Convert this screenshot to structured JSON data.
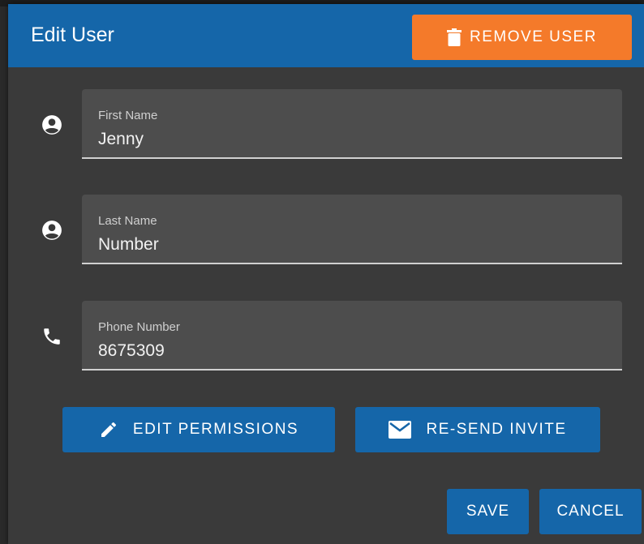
{
  "dialog": {
    "title": "Edit User",
    "remove_label": "REMOVE USER"
  },
  "fields": {
    "first_name": {
      "label": "First Name",
      "value": "Jenny",
      "icon": "account-circle-icon"
    },
    "last_name": {
      "label": "Last Name",
      "value": "Number",
      "icon": "account-circle-icon"
    },
    "phone": {
      "label": "Phone Number",
      "value": "8675309",
      "icon": "phone-icon"
    }
  },
  "actions": {
    "edit_permissions_label": "EDIT PERMISSIONS",
    "resend_invite_label": "RE-SEND INVITE"
  },
  "footer": {
    "save_label": "SAVE",
    "cancel_label": "CANCEL"
  },
  "colors": {
    "header": "#1566a9",
    "remove_button": "#f47a2a",
    "primary_button": "#1566a9",
    "dialog_bg": "#3a3a3a",
    "field_bg": "#4d4d4d"
  }
}
